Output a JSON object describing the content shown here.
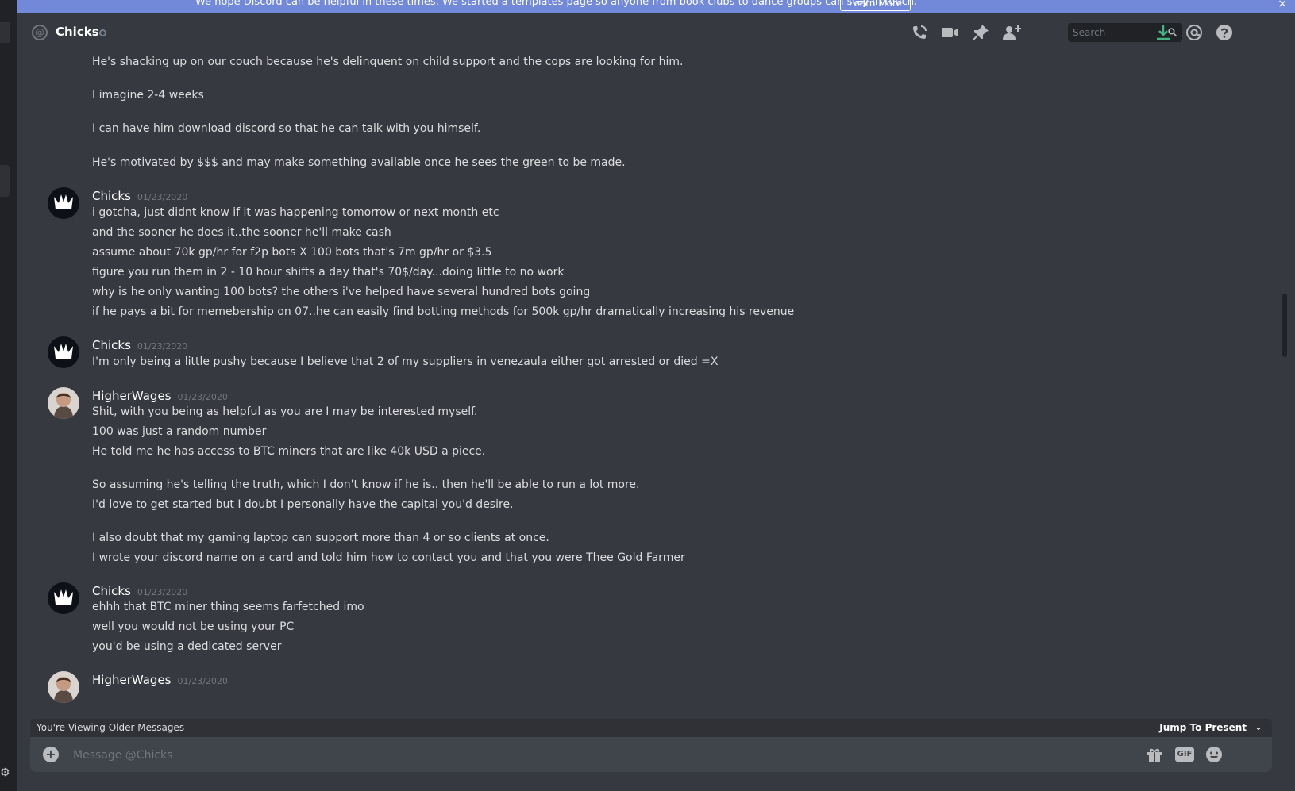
{
  "banner": {
    "text": "We hope Discord can be helpful in these times. We started a templates page so anyone from book clubs to dance groups can stay in touch.",
    "learn_more": "Learn More",
    "close": "×"
  },
  "header": {
    "channel_name": "Chicks",
    "search_placeholder": "Search"
  },
  "messages": {
    "g0": {
      "lines": [
        "He's shacking up on our couch because he's delinquent on child support and the cops are looking for him.",
        "I imagine 2-4 weeks",
        "I can have him download discord so that he can talk with you himself.",
        "He's motivated by $$$ and may make something available once he sees the green to be made."
      ]
    },
    "g1": {
      "author": "Chicks",
      "timestamp": "01/23/2020",
      "lines": [
        "i gotcha, just didnt know if it was happening tomorrow or next month etc",
        "and the sooner he does it..the sooner he'll make cash",
        "assume about 70k gp/hr for f2p bots X 100 bots that's 7m gp/hr or $3.5",
        "figure you run them in 2 - 10 hour shifts a day that's 70$/day...doing little to no work",
        "why is he only wanting 100 bots? the others i've helped have several hundred bots going",
        "if he pays a bit for memebership on 07..he can easily find botting methods for 500k gp/hr dramatically increasing his revenue"
      ]
    },
    "g2": {
      "author": "Chicks",
      "timestamp": "01/23/2020",
      "lines": [
        "I'm only being a little pushy because I believe that 2 of my suppliers in venezaula either got arrested or died =X"
      ]
    },
    "g3": {
      "author": "HigherWages",
      "timestamp": "01/23/2020",
      "lines": [
        "Shit, with you being as helpful as you are I may be interested myself.",
        "100 was just a random number",
        "He told me he has access to BTC miners that are like 40k USD a piece.",
        "So assuming he's telling the truth, which I don't know if he is.. then he'll be able to run a lot more.",
        "I'd love to get started but I doubt I personally have the capital you'd desire.",
        "I also doubt that my gaming laptop can support more than 4 or so clients at once.",
        "I wrote your discord name on a card and told him how to contact you and that you were Thee Gold Farmer"
      ]
    },
    "g4": {
      "author": "Chicks",
      "timestamp": "01/23/2020",
      "lines": [
        "ehhh that BTC miner thing seems farfetched imo",
        "well you would not be using your PC",
        "you'd be using a dedicated server"
      ]
    },
    "g5": {
      "author": "HigherWages",
      "timestamp": "01/23/2020"
    }
  },
  "older_bar": {
    "label": "You're Viewing Older Messages",
    "jump": "Jump To Present"
  },
  "composer": {
    "placeholder": "Message @Chicks",
    "gif_label": "GIF"
  },
  "colors": {
    "accent": "#7289da",
    "background": "#36393f",
    "download": "#43b581"
  }
}
